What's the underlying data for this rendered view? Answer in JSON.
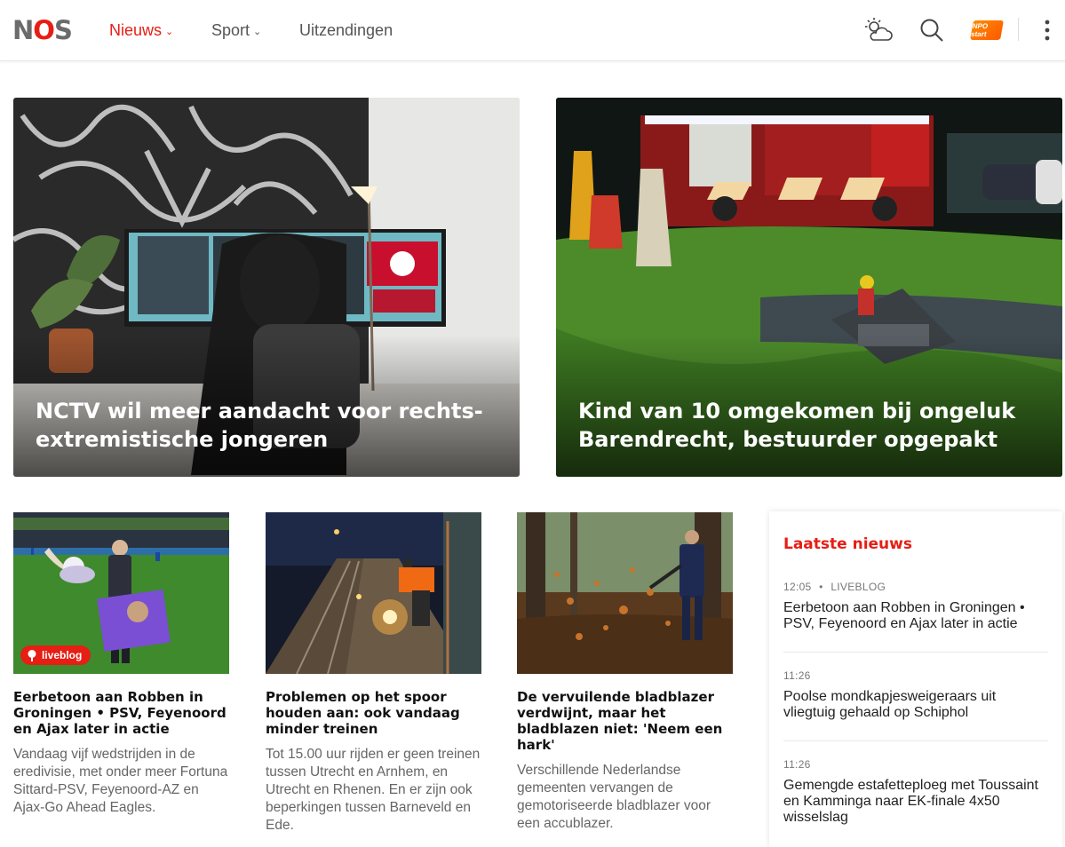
{
  "header": {
    "logo": "NOS",
    "nav": [
      {
        "label": "Nieuws",
        "dropdown": true,
        "active": true
      },
      {
        "label": "Sport",
        "dropdown": true,
        "active": false
      },
      {
        "label": "Uitzendingen",
        "dropdown": false,
        "active": false
      }
    ],
    "icons": [
      "weather-icon",
      "search-icon",
      "npo-start-icon",
      "more-menu-icon"
    ],
    "npo_label": "NPO start"
  },
  "hero": [
    {
      "title": "NCTV wil meer aandacht voor rechts-extremistische jongeren"
    },
    {
      "title": "Kind van 10 omgekomen bij ongeluk Barendrecht, bestuurder opgepakt"
    }
  ],
  "cards": [
    {
      "badge": "liveblog",
      "title": "Eerbetoon aan Robben in Groningen • PSV, Feyenoord en Ajax later in actie",
      "description": "Vandaag vijf wedstrijden in de eredivisie, met onder meer Fortuna Sittard-PSV, Feyenoord-AZ en Ajax-Go Ahead Eagles."
    },
    {
      "title": "Problemen op het spoor houden aan: ook vandaag minder treinen",
      "description": "Tot 15.00 uur rijden er geen treinen tussen Utrecht en Arnhem, en Utrecht en Rhenen. En er zijn ook beperkingen tussen Barneveld en Ede."
    },
    {
      "title": "De vervuilende bladblazer verdwijnt, maar het bladblazen niet: 'Neem een hark'",
      "description": "Verschillende Nederlandse gemeenten vervangen de gemotoriseerde bladblazer voor een accublazer."
    }
  ],
  "latest": {
    "heading": "Laatste nieuws",
    "items": [
      {
        "time": "12:05",
        "sep": "•",
        "tag": "LIVEBLOG",
        "title": "Eerbetoon aan Robben in Groningen • PSV, Feyenoord en Ajax later in actie"
      },
      {
        "time": "11:26",
        "title": "Poolse mondkapjesweigeraars uit vliegtuig gehaald op Schiphol"
      },
      {
        "time": "11:26",
        "title": "Gemengde estafetteploeg met Toussaint en Kamminga naar EK-finale 4x50 wisselslag"
      }
    ]
  },
  "colors": {
    "brand_red": "#e61e14",
    "text_gray": "#666666"
  }
}
